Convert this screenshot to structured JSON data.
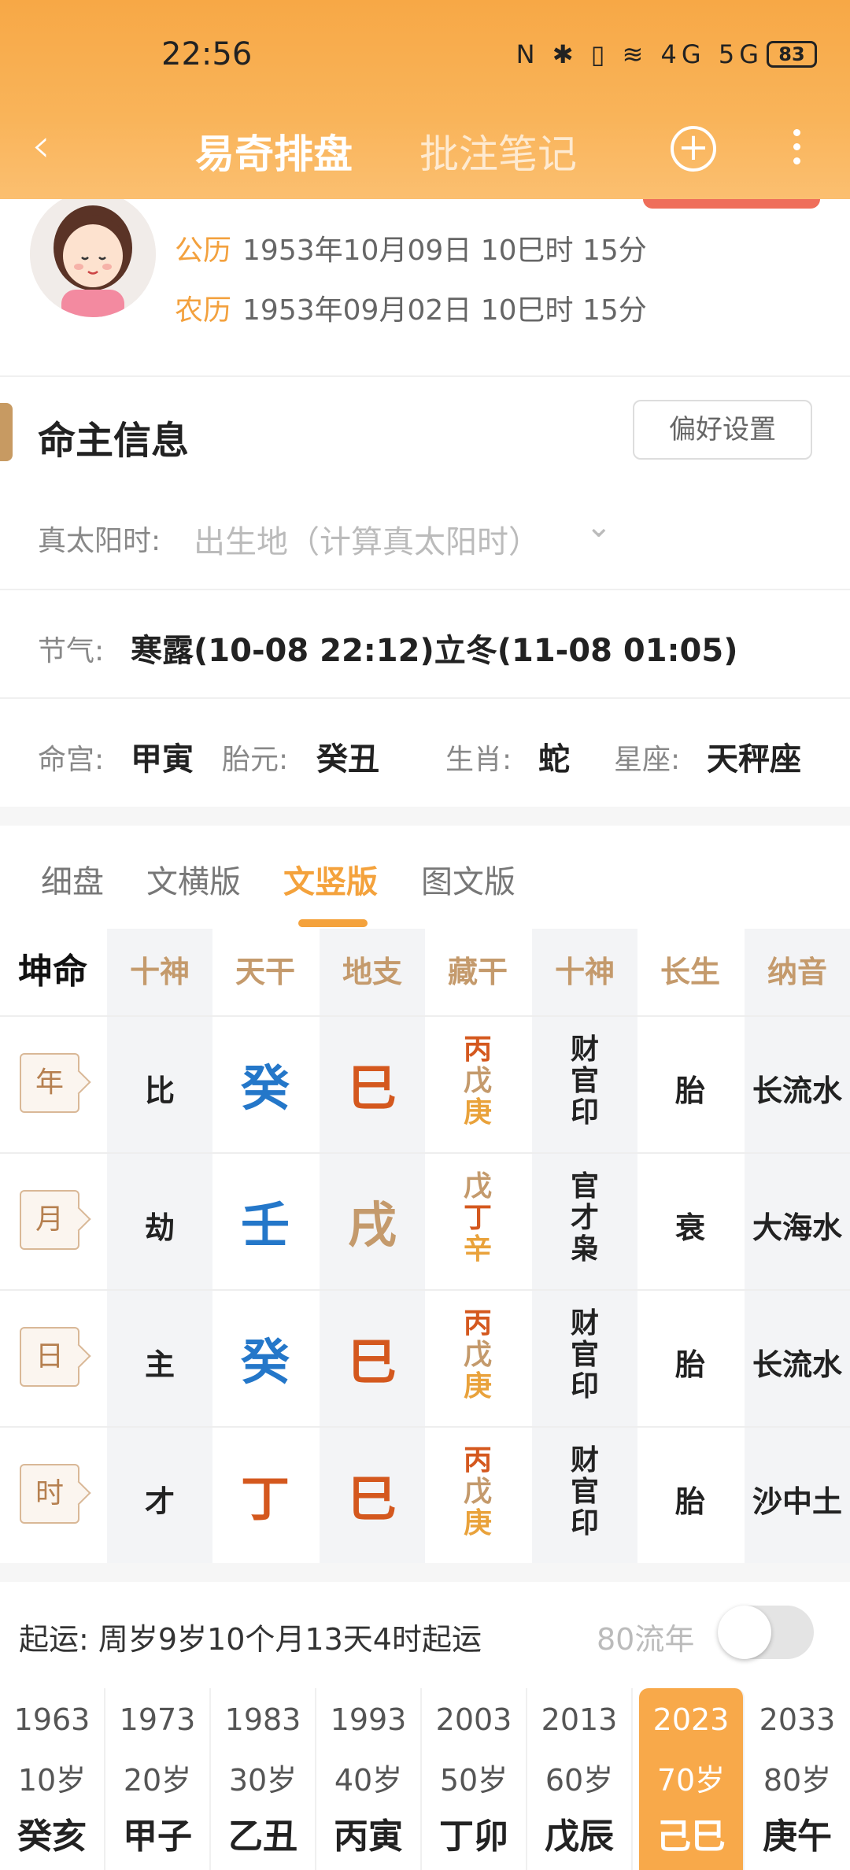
{
  "status": {
    "time": "22:56",
    "icons": "N ✱ ▯ ≋ 4G 5G",
    "battery": "83"
  },
  "nav": {
    "back": "‹",
    "title": "易奇排盘",
    "notes": "批注笔记",
    "add": "+"
  },
  "profile": {
    "solar_label": "公历",
    "solar_value": "1953年10月09日 10巳时 15分",
    "lunar_label": "农历",
    "lunar_value": "1953年09月02日 10巳时 15分"
  },
  "section": {
    "title": "命主信息",
    "pref_button": "偏好设置"
  },
  "true_solar": {
    "label": "真太阳时:",
    "placeholder": "出生地（计算真太阳时）",
    "chevron": "⌄"
  },
  "jieqi": {
    "label": "节气:",
    "value": "寒露(10-08 22:12)立冬(11-08 01:05)"
  },
  "palace": {
    "minggong_label": "命宫:",
    "minggong": "甲寅",
    "taiyuan_label": "胎元:",
    "taiyuan": "癸丑",
    "shengxiao_label": "生肖:",
    "shengxiao": "蛇",
    "xingzuo_label": "星座:",
    "xingzuo": "天秤座"
  },
  "tabs": [
    "细盘",
    "文横版",
    "文竖版",
    "图文版"
  ],
  "active_tab": "文竖版",
  "table": {
    "headers": [
      "坤命",
      "十神",
      "天干",
      "地支",
      "藏干",
      "十神",
      "长生",
      "纳音"
    ],
    "rows": [
      {
        "pillar": "年",
        "shishen": "比",
        "tiangan": "癸",
        "dizhi": "巳",
        "canggan": [
          "丙",
          "戊",
          "庚"
        ],
        "canggan_shishen": [
          "财",
          "官",
          "印"
        ],
        "changsheng": "胎",
        "nayin": "长流水"
      },
      {
        "pillar": "月",
        "shishen": "劫",
        "tiangan": "壬",
        "dizhi": "戌",
        "canggan": [
          "戊",
          "丁",
          "辛"
        ],
        "canggan_shishen": [
          "官",
          "才",
          "枭"
        ],
        "changsheng": "衰",
        "nayin": "大海水"
      },
      {
        "pillar": "日",
        "shishen": "主",
        "tiangan": "癸",
        "dizhi": "巳",
        "canggan": [
          "丙",
          "戊",
          "庚"
        ],
        "canggan_shishen": [
          "财",
          "官",
          "印"
        ],
        "changsheng": "胎",
        "nayin": "长流水"
      },
      {
        "pillar": "时",
        "shishen": "才",
        "tiangan": "丁",
        "dizhi": "巳",
        "canggan": [
          "丙",
          "戊",
          "庚"
        ],
        "canggan_shishen": [
          "财",
          "官",
          "印"
        ],
        "changsheng": "胎",
        "nayin": "沙中土"
      }
    ],
    "colors": {
      "water": "#2477c9",
      "fire": "#d4581e",
      "earth": "#c49a6c",
      "metal": "#e9a23b"
    }
  },
  "qiyun": {
    "text": "起运: 周岁9岁10个月13天4时起运",
    "liunian_label": "80流年"
  },
  "dayun": [
    {
      "year": "1963",
      "age": "10岁",
      "ganzhi": "癸亥"
    },
    {
      "year": "1973",
      "age": "20岁",
      "ganzhi": "甲子"
    },
    {
      "year": "1983",
      "age": "30岁",
      "ganzhi": "乙丑"
    },
    {
      "year": "1993",
      "age": "40岁",
      "ganzhi": "丙寅"
    },
    {
      "year": "2003",
      "age": "50岁",
      "ganzhi": "丁卯"
    },
    {
      "year": "2013",
      "age": "60岁",
      "ganzhi": "戊辰"
    },
    {
      "year": "2023",
      "age": "70岁",
      "ganzhi": "己巳"
    },
    {
      "year": "2033",
      "age": "80岁",
      "ganzhi": "庚午"
    }
  ],
  "active_dayun": "2023"
}
